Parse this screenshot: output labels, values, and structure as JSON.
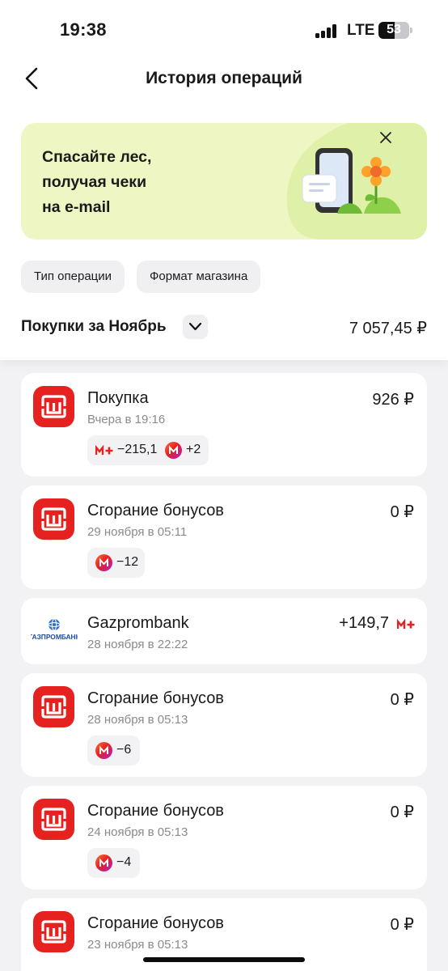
{
  "status_bar": {
    "time": "19:38",
    "network": "LTE",
    "battery": "53",
    "battery_level": 0.53
  },
  "header": {
    "title": "История операций"
  },
  "promo": {
    "title": "Спасайте лес,\nполучая чеки\nна e-mail",
    "accent_color": "#eef7c3"
  },
  "filters": [
    {
      "label": "Тип операции"
    },
    {
      "label": "Формат магазина"
    }
  ],
  "summary": {
    "label": "Покупки за Ноябрь",
    "total": "7 057,45 ₽"
  },
  "operations": [
    {
      "title": "Покупка",
      "date": "Вчера в 19:16",
      "amount": "926 ₽",
      "icon": "magnit-logo-icon",
      "bonuses": [
        {
          "icon": "m-plus-icon",
          "value": "−215,1"
        },
        {
          "icon": "magnit-coin-icon",
          "value": "+2"
        }
      ]
    },
    {
      "title": "Сгорание бонусов",
      "date": "29 ноября в 05:11",
      "amount": "0 ₽",
      "icon": "magnit-logo-icon",
      "bonuses": [
        {
          "icon": "magnit-coin-icon",
          "value": "−12"
        }
      ]
    },
    {
      "title": "Gazprombank",
      "date": "28 ноября в 22:22",
      "amount": "+149,7",
      "icon": "gazprombank-logo-icon",
      "logo_text": "ГАЗПРОМБАНК",
      "amount_icon": "m-plus-icon"
    },
    {
      "title": "Сгорание бонусов",
      "date": "28 ноября в 05:13",
      "amount": "0 ₽",
      "icon": "magnit-logo-icon",
      "bonuses": [
        {
          "icon": "magnit-coin-icon",
          "value": "−6"
        }
      ]
    },
    {
      "title": "Сгорание бонусов",
      "date": "24 ноября в 05:13",
      "amount": "0 ₽",
      "icon": "magnit-logo-icon",
      "bonuses": [
        {
          "icon": "magnit-coin-icon",
          "value": "−4"
        }
      ]
    },
    {
      "title": "Сгорание бонусов",
      "date": "23 ноября в 05:13",
      "amount": "0 ₽",
      "icon": "magnit-logo-icon"
    }
  ],
  "colors": {
    "brand_red": "#e5221f",
    "background": "#f2f2f4",
    "muted_text": "#8a8a8f"
  }
}
